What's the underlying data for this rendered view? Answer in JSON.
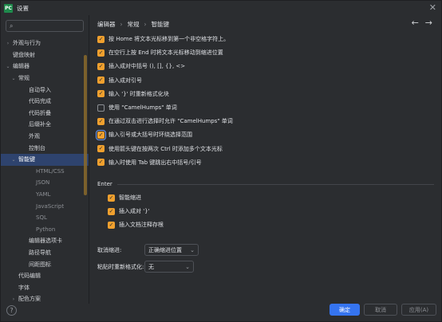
{
  "window": {
    "title": "设置",
    "logo_text": "PC",
    "close_glyph": "✕"
  },
  "search": {
    "value": "",
    "placeholder": "",
    "icon": "search-icon",
    "glyph": "⌕"
  },
  "tree": [
    {
      "label": "外观与行为",
      "arrow": "›",
      "level": 0
    },
    {
      "label": "键盘映射",
      "arrow": "",
      "level": 0
    },
    {
      "label": "编辑器",
      "arrow": "⌄",
      "level": 0
    },
    {
      "label": "常规",
      "arrow": "⌄",
      "level": 1
    },
    {
      "label": "自动导入",
      "arrow": "",
      "level": 2
    },
    {
      "label": "代码完成",
      "arrow": "",
      "level": 2
    },
    {
      "label": "代码折叠",
      "arrow": "",
      "level": 2
    },
    {
      "label": "后缀补全",
      "arrow": "",
      "level": 2
    },
    {
      "label": "外观",
      "arrow": "",
      "level": 2
    },
    {
      "label": "控制台",
      "arrow": "",
      "level": 2
    },
    {
      "label": "智能键",
      "arrow": "⌄",
      "level": 1,
      "selected": true
    },
    {
      "label": "HTML/CSS",
      "arrow": "",
      "level": 3
    },
    {
      "label": "JSON",
      "arrow": "",
      "level": 3
    },
    {
      "label": "YAML",
      "arrow": "",
      "level": 3
    },
    {
      "label": "JavaScript",
      "arrow": "",
      "level": 3
    },
    {
      "label": "SQL",
      "arrow": "",
      "level": 3
    },
    {
      "label": "Python",
      "arrow": "",
      "level": 3
    },
    {
      "label": "编辑器选项卡",
      "arrow": "",
      "level": 2
    },
    {
      "label": "路径导航",
      "arrow": "",
      "level": 2
    },
    {
      "label": "间距图标",
      "arrow": "",
      "level": 2
    },
    {
      "label": "代码编辑",
      "arrow": "",
      "level": 1
    },
    {
      "label": "字体",
      "arrow": "",
      "level": 1
    },
    {
      "label": "配色方案",
      "arrow": "›",
      "level": 1
    }
  ],
  "breadcrumb": {
    "items": [
      "编辑器",
      "常规",
      "智能键"
    ],
    "sep": "›"
  },
  "nav": {
    "back": "←",
    "forward": "→"
  },
  "options": [
    {
      "label": "按 Home 将文本光标移到第一个非空格字符上。",
      "checked": true
    },
    {
      "label": "在空行上按 End 时将文本光标移动到缩进位置",
      "checked": true
    },
    {
      "label": "插入成对中括号 (), [], {}, <>",
      "checked": true
    },
    {
      "label": "插入成对引号",
      "checked": true
    },
    {
      "label": "输入 '}' 时重新格式化块",
      "checked": true
    },
    {
      "label": "使用 \"CamelHumps\" 单词",
      "checked": false
    },
    {
      "label": "在通过双击进行选择时允许 \"CamelHumps\" 单词",
      "checked": true
    },
    {
      "label": "输入引号或大括号时环绕选择范围",
      "checked": true,
      "focused": true
    },
    {
      "label": "使用箭头键在按两次 Ctrl 时添加多个文本光标",
      "checked": true
    },
    {
      "label": "输入时使用 Tab 键跳出右中括号/引号",
      "checked": true
    }
  ],
  "enter_section": {
    "title": "Enter",
    "options": [
      {
        "label": "智能缩进",
        "checked": true
      },
      {
        "label": "插入成对 '}'",
        "checked": true
      },
      {
        "label": "插入文档注释存根",
        "checked": true
      }
    ]
  },
  "unindent": {
    "label": "取消缩进:",
    "value": "正确缩进位置"
  },
  "reformat": {
    "label": "粘贴时重新格式化:",
    "value": "无"
  },
  "check_glyph": "✓",
  "chevron_glyph": "⌄",
  "help_glyph": "?",
  "footer": {
    "ok": "确定",
    "cancel": "取消",
    "apply": "应用(A)"
  },
  "colors": {
    "accent": "#3574f0",
    "checkbox": "#f0a02e",
    "selection": "#2e436e",
    "background": "#2b2d30"
  }
}
